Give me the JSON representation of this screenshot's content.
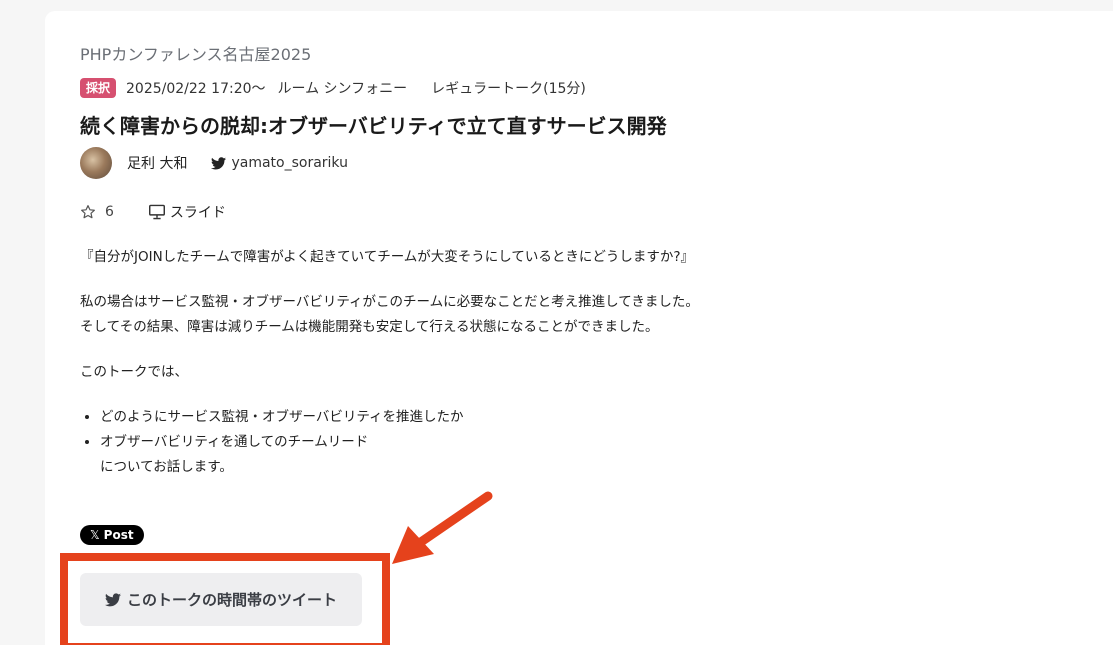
{
  "event": {
    "name": "PHPカンファレンス名古屋2025"
  },
  "talk": {
    "badge": "採択",
    "datetime": "2025/02/22 17:20〜",
    "room": "ルーム シンフォニー",
    "type": "レギュラートーク(15分)",
    "title": "続く障害からの脱却:オブザーバビリティで立て直すサービス開発"
  },
  "speaker": {
    "name": "足利 大和",
    "twitter": "yamato_sorariku"
  },
  "actions": {
    "star_count": "6",
    "slide_label": "スライド"
  },
  "description": {
    "line1": "『自分がJOINしたチームで障害がよく起きていてチームが大変そうにしているときにどうしますか?』",
    "line2": "私の場合はサービス監視・オブザーバビリティがこのチームに必要なことだと考え推進してきました。",
    "line3": "そしてその結果、障害は減りチームは機能開発も安定して行える状態になることができました。",
    "line4": "このトークでは、",
    "bullets": [
      "どのようにサービス監視・オブザーバビリティを推進したか",
      "オブザーバビリティを通してのチームリード"
    ],
    "tail": "についてお話します。"
  },
  "share": {
    "x_post_label": "Post",
    "x_mark": "𝕏",
    "tweet_timeline_label": "このトークの時間帯のツイート"
  },
  "colors": {
    "badge": "#d65070",
    "annotation": "#e5421c",
    "button_bg": "#eeeef0"
  },
  "icons": {
    "bird": "twitter-bird-icon",
    "star": "star-outline-icon",
    "slide": "monitor-icon"
  }
}
